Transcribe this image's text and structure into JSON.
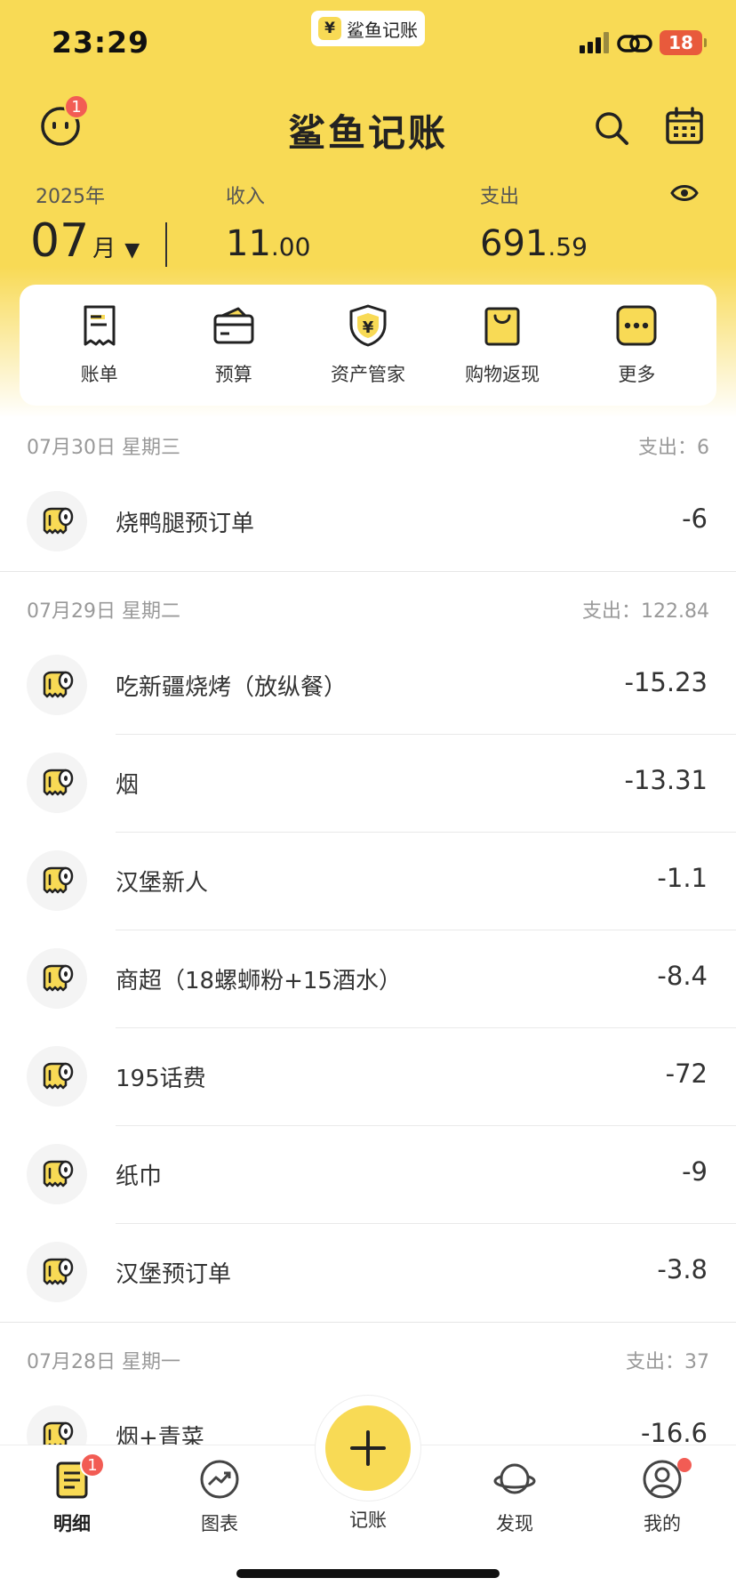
{
  "status_bar": {
    "time": "23:29",
    "battery": "18",
    "app_pill": {
      "logo": "¥",
      "name": "鲨鱼记账"
    }
  },
  "header": {
    "title": "鲨鱼记账",
    "avatar_badge": "1",
    "year": "2025年",
    "month_num": "07",
    "month_unit": "月",
    "month_caret": "▼",
    "income_label": "收入",
    "income_int": "11",
    "income_dec": ".00",
    "expense_label": "支出",
    "expense_int": "691",
    "expense_dec": ".59"
  },
  "quick_menu": [
    {
      "label": "账单",
      "icon": "bill-icon"
    },
    {
      "label": "预算",
      "icon": "wallet-icon"
    },
    {
      "label": "资产管家",
      "icon": "shield-yen-icon"
    },
    {
      "label": "购物返现",
      "icon": "shopping-bag-icon"
    },
    {
      "label": "更多",
      "icon": "more-dots-icon"
    }
  ],
  "groups": [
    {
      "date": "07月30日  星期三",
      "total": "支出：6",
      "items": [
        {
          "name": "烧鸭腿预订单",
          "amount": "-6"
        }
      ]
    },
    {
      "date": "07月29日  星期二",
      "total": "支出：122.84",
      "items": [
        {
          "name": "吃新疆烧烤（放纵餐）",
          "amount": "-15.23"
        },
        {
          "name": "烟",
          "amount": "-13.31"
        },
        {
          "name": "汉堡新人",
          "amount": "-1.1"
        },
        {
          "name": "商超（18螺蛳粉+15酒水）",
          "amount": "-8.4"
        },
        {
          "name": "195话费",
          "amount": "-72"
        },
        {
          "name": "纸巾",
          "amount": "-9"
        },
        {
          "name": "汉堡预订单",
          "amount": "-3.8"
        }
      ]
    },
    {
      "date": "07月28日  星期一",
      "total": "支出：37",
      "items": [
        {
          "name": "烟+青菜",
          "amount": "-16.6"
        }
      ]
    }
  ],
  "tabs": [
    {
      "label": "明细",
      "icon": "detail-list-icon",
      "badge": "1"
    },
    {
      "label": "图表",
      "icon": "chart-icon"
    },
    {
      "label": "记账",
      "icon": "plus-icon"
    },
    {
      "label": "发现",
      "icon": "planet-icon"
    },
    {
      "label": "我的",
      "icon": "profile-icon"
    }
  ],
  "colors": {
    "brand_yellow": "#f8da55",
    "badge_red": "#f25c54",
    "text": "#333333",
    "muted": "#999999"
  }
}
